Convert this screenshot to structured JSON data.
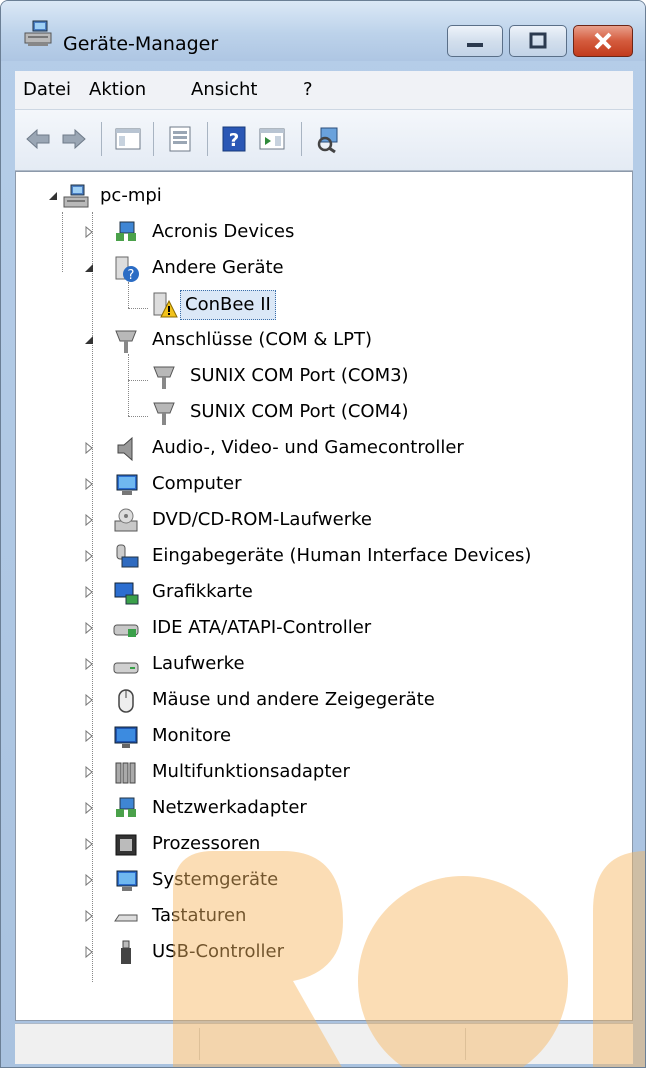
{
  "window": {
    "title": "Geräte-Manager",
    "accent_color": "#b5cde8",
    "watermark_color": "#f5b760"
  },
  "menubar": {
    "items": [
      "Datei",
      "Aktion",
      "Ansicht",
      "?"
    ]
  },
  "toolbar": {
    "buttons": [
      "back-arrow-icon",
      "forward-arrow-icon",
      "show-hide-console-tree-icon",
      "properties-icon",
      "help-icon",
      "show-action-pane-icon",
      "scan-hardware-changes-icon"
    ]
  },
  "tree": {
    "root": "pc-mpi",
    "items": [
      {
        "label": "Acronis Devices",
        "icon": "network-icon",
        "expanded": false
      },
      {
        "label": "Andere Geräte",
        "icon": "unknown-device-icon",
        "expanded": true
      },
      {
        "label": "ConBee II",
        "icon": "warning-device-icon",
        "selected": true
      },
      {
        "label": "Anschlüsse (COM & LPT)",
        "icon": "port-icon",
        "expanded": true
      },
      {
        "label": "SUNIX COM Port (COM3)",
        "icon": "port-icon"
      },
      {
        "label": "SUNIX COM Port (COM4)",
        "icon": "port-icon"
      },
      {
        "label": "Audio-, Video- und Gamecontroller",
        "icon": "speaker-icon",
        "expanded": false
      },
      {
        "label": "Computer",
        "icon": "computer-icon",
        "expanded": false
      },
      {
        "label": "DVD/CD-ROM-Laufwerke",
        "icon": "dvd-drive-icon",
        "expanded": false
      },
      {
        "label": "Eingabegeräte (Human Interface Devices)",
        "icon": "hid-icon",
        "expanded": false
      },
      {
        "label": "Grafikkarte",
        "icon": "display-adapter-icon",
        "expanded": false
      },
      {
        "label": "IDE ATA/ATAPI-Controller",
        "icon": "ide-controller-icon",
        "expanded": false
      },
      {
        "label": "Laufwerke",
        "icon": "disk-drive-icon",
        "expanded": false
      },
      {
        "label": "Mäuse und andere Zeigegeräte",
        "icon": "mouse-icon",
        "expanded": false
      },
      {
        "label": "Monitore",
        "icon": "monitor-icon",
        "expanded": false
      },
      {
        "label": "Multifunktionsadapter",
        "icon": "multifunction-adapter-icon",
        "expanded": false
      },
      {
        "label": "Netzwerkadapter",
        "icon": "network-adapter-icon",
        "expanded": false
      },
      {
        "label": "Prozessoren",
        "icon": "processor-icon",
        "expanded": false
      },
      {
        "label": "Systemgeräte",
        "icon": "system-devices-icon",
        "expanded": false
      },
      {
        "label": "Tastaturen",
        "icon": "keyboard-icon",
        "expanded": false
      },
      {
        "label": "USB-Controller",
        "icon": "usb-icon",
        "expanded": false
      }
    ]
  }
}
